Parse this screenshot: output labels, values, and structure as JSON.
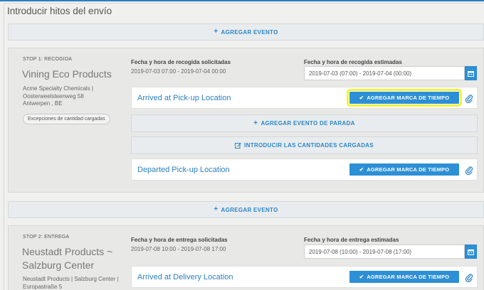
{
  "page": {
    "title": "Introducir hitos del envío"
  },
  "add_event_label": "AGREGAR EVENTO",
  "stops": [
    {
      "label": "STOP 1: RECOGIDA",
      "name": "Vining Eco Products",
      "address": [
        "Acme Specialty Chemicals |",
        "Oosterweelsteenweg 58",
        "Antwerpen , BE"
      ],
      "exceptions_button": "Excepciones de cantidad cargadas",
      "requested_label": "Fecha y hora de recogida solicitadas",
      "requested_value": "2019-07-03 07:00 - 2019-07-04 00:00",
      "estimated_label": "Fecha y hora de recogida estimadas",
      "estimated_value": "2019-07-03  (07:00) - 2019-07-04  (00:00)",
      "events": [
        {
          "name": "Arrived at Pick-up Location",
          "button": "AGREGAR MARCA DE TIEMPO"
        },
        {
          "name": "Departed Pick-up Location",
          "button": "AGREGAR MARCA DE TIEMPO"
        }
      ],
      "add_stop_event": "AGREGAR EVENTO DE PARADA",
      "enter_quantities": "INTRODUCIR LAS CANTIDADES CARGADAS"
    },
    {
      "label": "STOP 2: ENTREGA",
      "name": "Neustadt Products ~ Salzburg Center",
      "address": [
        "Neustadt Products | Salzburg Center |",
        "Europastraße 5"
      ],
      "requested_label": "Fecha y hora de entrega solicitadas",
      "requested_value": "2019-07-08 10:00 - 2019-07-08 17:00",
      "estimated_label": "Fecha y hora de entrega estimadas",
      "estimated_value": "2019-07-08  (10:00) - 2019-07-08  (17:00)",
      "events": [
        {
          "name": "Arrived at Delivery Location",
          "button": "AGREGAR MARCA DE TIEMPO"
        }
      ]
    }
  ],
  "colors": {
    "accent": "#2d8fd5",
    "link": "#2a7fc1",
    "highlight": "#f2f23a"
  }
}
